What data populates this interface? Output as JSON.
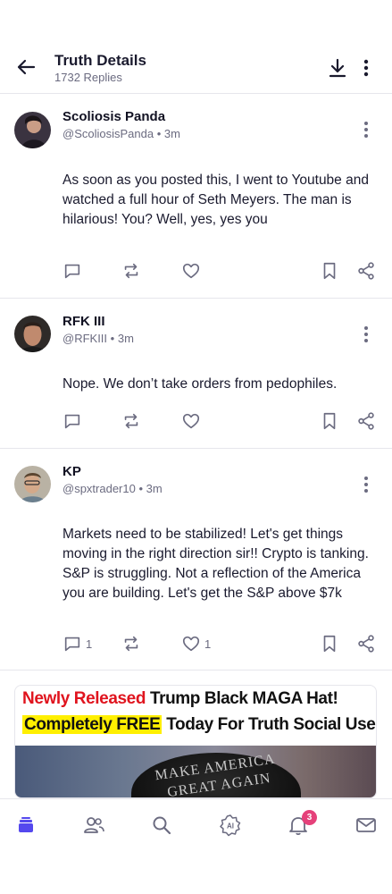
{
  "header": {
    "title": "Truth Details",
    "subtitle": "1732 Replies",
    "back_icon": "arrow-left-icon",
    "download_icon": "download-icon",
    "more_icon": "more-vertical-icon"
  },
  "posts": [
    {
      "name": "Scoliosis Panda",
      "handle": "@ScoliosisPanda",
      "time": "3m",
      "text": "As soon as you posted this, I went to Youtube and watched a full hour of Seth Meyers. The man is hilarious! You? Well, yes, yes you",
      "reply_count": "",
      "like_count": ""
    },
    {
      "name": "RFK III",
      "handle": "@RFKIII",
      "time": "3m",
      "text": "Nope. We don’t take orders from pedophiles.",
      "reply_count": "",
      "like_count": ""
    },
    {
      "name": "KP",
      "handle": "@spxtrader10",
      "time": "3m",
      "text": "Markets need to be stabilized! Let's get things moving in the right direction sir!! Crypto is tanking. S&P is struggling. Not a reflection of the America you are building. Let's get the S&P above $7k",
      "reply_count": "1",
      "like_count": "1"
    }
  ],
  "ad": {
    "line1_red": "Newly Released",
    "line1_black": "Trump Black MAGA Hat!",
    "line2_highlight": "Completely FREE",
    "line2_black": "Today For Truth Social Users!",
    "hat_line1": "MAKE AMERICA",
    "hat_line2": "GREAT AGAIN"
  },
  "tabbar": {
    "items": [
      "home-icon",
      "groups-icon",
      "search-icon",
      "ai-icon",
      "notifications-icon",
      "messages-icon"
    ],
    "notification_badge": "3",
    "accent": "#5448ee"
  },
  "separator": "•"
}
